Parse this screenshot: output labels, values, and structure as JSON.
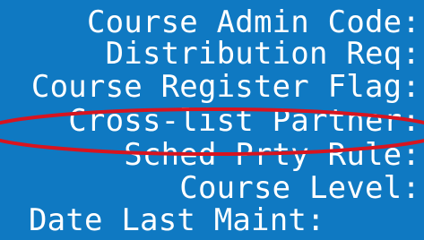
{
  "labels": {
    "course_admin_code": "Course Admin Code:",
    "distribution_req": "Distribution Req:",
    "course_register_flag": "Course Register Flag:",
    "cross_list_partner": "Cross-list Partner:",
    "sched_prty_rule": "Sched Prty Rule:",
    "course_level": "Course Level:",
    "date_last_maint": "Date Last Maint:"
  },
  "colors": {
    "background": "#0f79c2",
    "text": "#ffffff",
    "highlight_ring": "#d8141f"
  }
}
